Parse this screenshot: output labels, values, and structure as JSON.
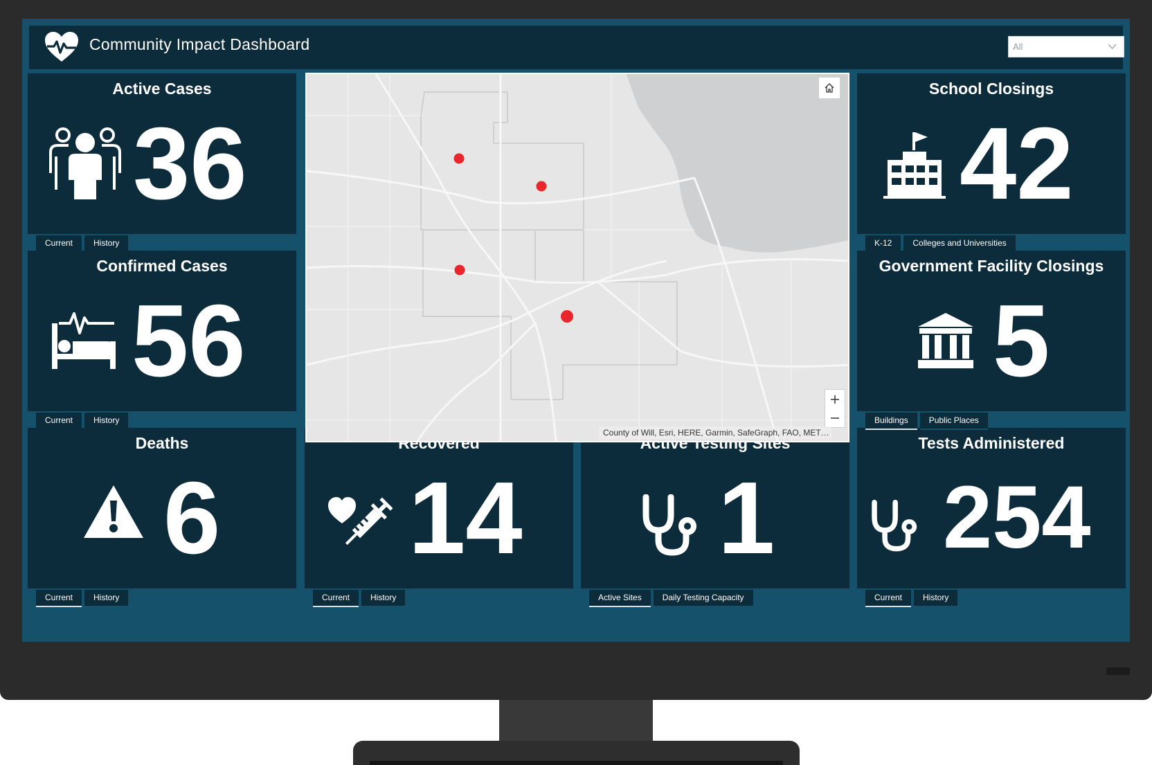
{
  "header": {
    "title": "Community Impact Dashboard",
    "filter_value": "All"
  },
  "panels": {
    "active_cases": {
      "title": "Active Cases",
      "value": "36",
      "icon": "people-icon",
      "tabs": [
        "Current",
        "History"
      ]
    },
    "confirmed_cases": {
      "title": "Confirmed Cases",
      "value": "56",
      "icon": "hospital-bed-icon",
      "tabs": [
        "Current",
        "History"
      ]
    },
    "deaths": {
      "title": "Deaths",
      "value": "6",
      "icon": "warning-icon",
      "tabs": [
        "Current",
        "History"
      ]
    },
    "recovered": {
      "title": "Recovered",
      "value": "14",
      "icon": "heart-syringe-icon",
      "tabs": [
        "Current",
        "History"
      ]
    },
    "testing_sites": {
      "title": "Active Testing Sites",
      "value": "1",
      "icon": "stethoscope-icon",
      "tabs": [
        "Active Sites",
        "Daily Testing Capacity"
      ]
    },
    "tests": {
      "title": "Tests Administered",
      "value": "254",
      "icon": "stethoscope-icon",
      "tabs": [
        "Current",
        "History"
      ]
    },
    "school_closings": {
      "title": "School Closings",
      "value": "42",
      "icon": "school-icon",
      "tabs": [
        "K-12",
        "Colleges and Universities"
      ]
    },
    "gov_closings": {
      "title": "Government Facility Closings",
      "value": "5",
      "icon": "government-building-icon",
      "tabs": [
        "Buildings",
        "Public Places"
      ]
    }
  },
  "map": {
    "attribution": "County of Will, Esri, HERE, Garmin, SafeGraph, FAO, METI/NASA, USGS, EPA, NPS",
    "zoom_in_label": "+",
    "zoom_out_label": "−",
    "marker_color": "#e8262b",
    "water_color": "#cfd0d2"
  },
  "colors": {
    "screen_background": "#16516b",
    "panel_background": "#0d2c3b",
    "text": "#ffffff"
  }
}
